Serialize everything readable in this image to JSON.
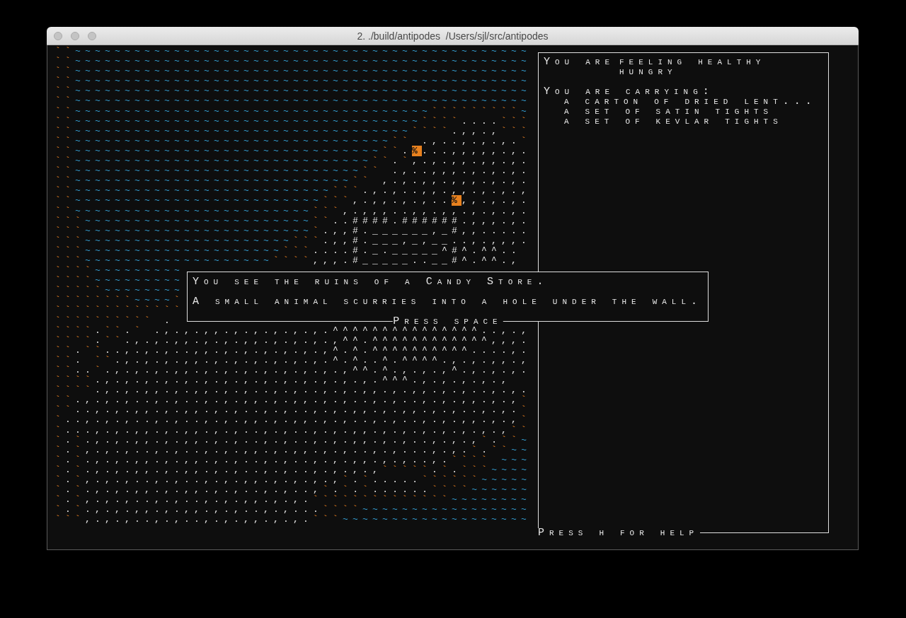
{
  "window": {
    "title": "2. ./build/antipodes  /Users/sjl/src/antipodes"
  },
  "map": {
    "rows": [
      "``~~~~~~~~~~~~~~~~~~~~~~~~~~~~~~~~~~~~~~~~~~~~~~",
      "``~~~~~~~~~~~~~~~~~~~~~~~~~~~~~~~~~~~~~~~~~~~~~~",
      "``~~~~~~~~~~~~~~~~~~~~~~~~~~~~~~~~~~~~~~~~~~~~~~",
      "``~~~~~~~~~~~~~~~~~~~~~~~~~~~~~~~~~~~~~~~~~~~~~~",
      "``~~~~~~~~~~~~~~~~~~~~~~~~~~~~~~~~~~~~~~~~~~~~~~",
      "``~~~~~~~~~~~~~~~~~~~~~~~~~~~~~~~~~~~~~~~~~~~~~~",
      "``~~~~~~~~~~~~~~~~~~~~~~~~~~~~~~~~~~~~`````````~",
      "``~~~~~~~~~~~~~~~~~~~~~~~~~~~~~~~~~~~````....```",
      "``~~~~~~~~~~~~~~~~~~~~~~~~~~~~~~~~~~````.,,.,```",
      "``~~~~~~~~~~~~~~~~~~~~~~~~~~~~~~~~`` .,..,.,.,.`",
      "``~~~~~~~~~~~~~~~~~~~~~~~~~~~~~~~``.%...,,,,,.,.",
      "``~~~~~~~~~~~~~~~~~~~~~~~~~~~~~~``.`,.,.,,.,,.,.",
      "``~~~~~~~~~~~~~~~~~~~~~~~~~~~~~`` .,..,,,.,.,.,.",
      "``~~~~~~~~~~~~~~~~~~~~~~~~~~~~`` ,.,.,,.,,,.,.,.",
      "``~~~~~~~~~~~~~~~~~~~~~~~~~~```.,.,..,,.,,.,.,.,",
      "``~~~~~~~~~~~~~~~~~~~~~~~~~```,.,,.,.,..%,,.,.,.",
      "``~~~~~~~~~~~~~~~~~~~~~~~~```,.,,,..,,.,,.,.,.,.",
      "```~~~~~~~~~~~~~~~~~~~~~~~``..####.######.,,,.,.",
      "```~~~~~~~~~~~~~~~~~~~~~~~`.,,#.______,_#,,.....",
      "```~~~~~~~~~~~~~~~~~~~~~```.,,#.___,_,__..,.,,,.",
      "```~~~~~~~~~~~~~~~~~~~~```....#._._____^#^.^^.. ",
      "```~~~~~~~~~~~~~~~~~~~````,,,.#_____..__#^.^^., ",
      "````~~~~~~~~~",
      "````~~~~~~~~~",
      "`````~~~~~~~~",
      "````````~~~~`",
      "`````````````",
      "`````````` .",
      "````.``.` .,.,.,,.,.,.,.,.,.^^^^^^^^^^^^^^^..,.,",
      "````.``.,.,.,,.,.,.,,.,.,.,.,^^.^^^^^^^^^^^^,,,.",
      "``.``..,.,.,..,,.,.,.,.,.,.,^.^.^^^^^^^^^^....,.",
      "``. ``.,.,.,.,,.,.,.,.,.,.,.^.^..^.^^^^.,.,.,,.,",
      "``..`.,.,.,.,,.,.,.,.,.,.,.,.,^^.^.,.,.,^.,.,.,.",
      "````.,.,.,.,.,.,.,.,.,.,.,.,.,.,.^^^.,.,.,.,.,",
      "````.,.,.,,.,.,,.,.,..,.,..,.,.,,.,.,,.,.,..,.,.",
      "``.,.,.,..,.,..,.,.,,.,.,,.,.,..,.,..,.,.,,.,.,`",
      "``..,.,.,,.,.,,.,.,..,.,..,.,.,,.,.,,.,.,..,.,.`",
      "`..,.,.,..,.,..,.,.,,.,.,,.,.,..,.,..,.,.,,.,.,`",
      "`...,.,.,,.,.,,.,.,..,.,..,.,.,,.,.,.,.,.,.,.,``",
      "`.`.,.,.,,.,.,,.,.,..,.,..,.,.,,.,.,..,.,.,`.``~",
      "`.`,.,.,..,.,..,.,.,,.,.,,.,.,..,.,...,.,.`.``~~",
      "`.`.,.,.,,.,.,,.,.,..,.,..,.,.,,.,.,..,.```` ~~~",
      "`.`.,.,.,,.,.,,.,.,..,.,..,.,.,.,`````.`.```~~~~",
      "`.`,.,.,..,.,..,.,.,,.,.,.,.,`.`.....``````~~~~~",
      "`.`.,.,.,,.,.,,.,.,..,.,..,`.`.`......````~~~~~~",
      "`.`,.,.,..,.,..,.,.,,.,.,.``````````````~~~~~~~~",
      "`.`.,.,.,,.,.,,.,.,..,.,...````~~~~~~~~~~~~~~~~~",
      "```,.,.,..,.,..,.,.,,.,.,.```~~~~~~~~~~~~~~~~~~~"
    ]
  },
  "status_panel": {
    "lead": "You are",
    "states": [
      "feeling healthy",
      "hungry"
    ],
    "carrying_label": "You are carrying:",
    "inventory": [
      "a carton of dried lent...",
      "a set of satin tights",
      "a set of kevlar tights"
    ],
    "help_hint": "Press h for help"
  },
  "message": {
    "lines": [
      "You see the ruins of a Candy Store.",
      "A small animal scurries into a hole under the wall."
    ],
    "prompt": "Press space"
  }
}
